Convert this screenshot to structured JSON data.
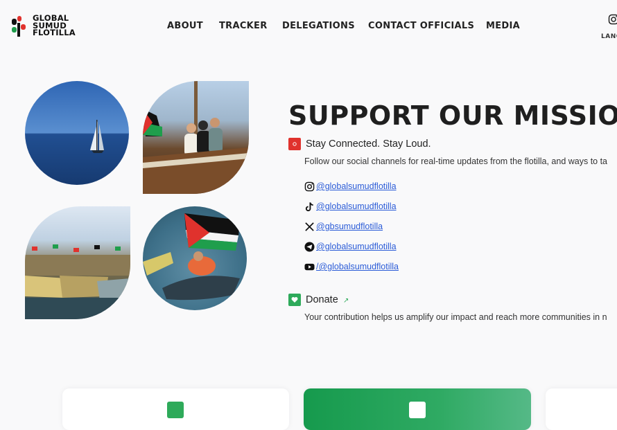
{
  "brand": {
    "line1": "GLOBAL",
    "line2": "SUMUD",
    "line3": "FLOTILLA",
    "colors": {
      "red": "#e0322d",
      "green": "#1f9e4c",
      "black": "#111111"
    }
  },
  "nav": {
    "items": [
      "ABOUT",
      "TRACKER",
      "DELEGATIONS",
      "CONTACT OFFICIALS",
      "MEDIA"
    ]
  },
  "header": {
    "lang_label": "LANG",
    "instagram_icon": "instagram-icon"
  },
  "photos": [
    {
      "name": "sailboat-on-sea-photo"
    },
    {
      "name": "people-on-boat-photo"
    },
    {
      "name": "boats-in-harbor-photo"
    },
    {
      "name": "flag-on-boat-photo"
    }
  ],
  "main": {
    "title": "SUPPORT OUR MISSION",
    "stay": {
      "title": "Stay Connected. Stay Loud.",
      "desc": "Follow our social channels for real-time updates from the flotilla, and ways to ta",
      "icon_color": "#e0322d"
    },
    "socials": [
      {
        "icon": "instagram-icon",
        "handle": "@globalsumudflotilla"
      },
      {
        "icon": "tiktok-icon",
        "handle": "@globalsumudflotilla"
      },
      {
        "icon": "x-icon",
        "handle": "@gbsumudflotilla"
      },
      {
        "icon": "telegram-icon",
        "handle": "@globalsumudflotilla"
      },
      {
        "icon": "youtube-icon",
        "handle": "/@globalsumudflotilla"
      }
    ],
    "donate": {
      "title": "Donate",
      "desc": "Your contribution helps us amplify our impact and reach more communities in n",
      "icon_color": "#2eaa5a"
    }
  },
  "accent": {
    "link": "#2a5bd7",
    "green": "#1f9e4c"
  }
}
